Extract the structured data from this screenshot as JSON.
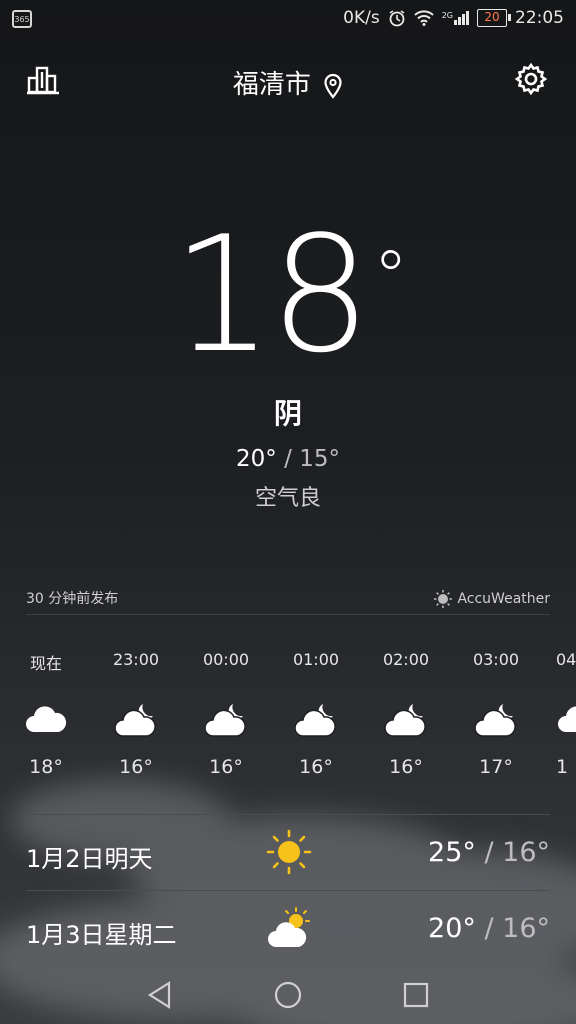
{
  "status_bar": {
    "app_badge": "365",
    "net_speed": "0K/s",
    "network": "2G",
    "battery": "20",
    "time": "22:05"
  },
  "header": {
    "city": "福清市"
  },
  "current": {
    "temp": "18",
    "condition": "阴",
    "high": "20°",
    "low": "15°",
    "air_quality": "空气良"
  },
  "publish": {
    "text": "30 分钟前发布",
    "provider": "AccuWeather"
  },
  "hourly": [
    {
      "time": "现在",
      "icon": "cloud-icon",
      "temp": "18°"
    },
    {
      "time": "23:00",
      "icon": "cloud-moon-icon",
      "temp": "16°"
    },
    {
      "time": "00:00",
      "icon": "cloud-moon-icon",
      "temp": "16°"
    },
    {
      "time": "01:00",
      "icon": "cloud-moon-icon",
      "temp": "16°"
    },
    {
      "time": "02:00",
      "icon": "cloud-moon-icon",
      "temp": "16°"
    },
    {
      "time": "03:00",
      "icon": "cloud-moon-icon",
      "temp": "17°"
    },
    {
      "time": "04",
      "icon": "cloud-icon",
      "temp": "1"
    }
  ],
  "daily": [
    {
      "label": "1月2日明天",
      "icon": "sun-icon",
      "high": "25°",
      "low": "16°"
    },
    {
      "label": "1月3日星期二",
      "icon": "partly-cloudy-icon",
      "high": "20°",
      "low": "16°"
    }
  ],
  "colors": {
    "sun": "#f7c21b",
    "battery_text": "#ff7a4d"
  }
}
